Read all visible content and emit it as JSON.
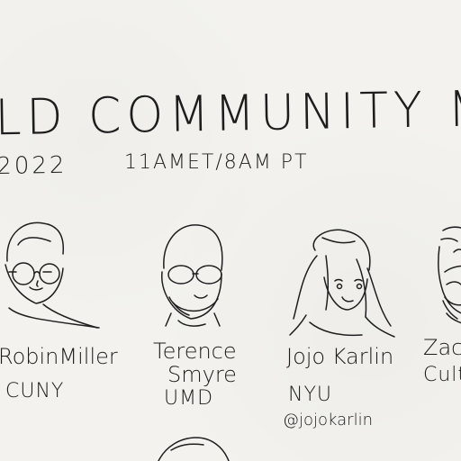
{
  "header": {
    "title": "LD COMMUNITY MEETU",
    "date": "2022",
    "time": "11AMET/8AM PT"
  },
  "speakers": [
    {
      "name": "RobinMiller",
      "affiliation": "CUNY"
    },
    {
      "name_line1": "Terence",
      "name_line2": "Smyre",
      "affiliation": "UMD"
    },
    {
      "name": "Jojo Karlin",
      "affiliation": "NYU",
      "handle": "@jojokarlin"
    },
    {
      "name": "Zac",
      "affiliation": "Cult"
    }
  ]
}
